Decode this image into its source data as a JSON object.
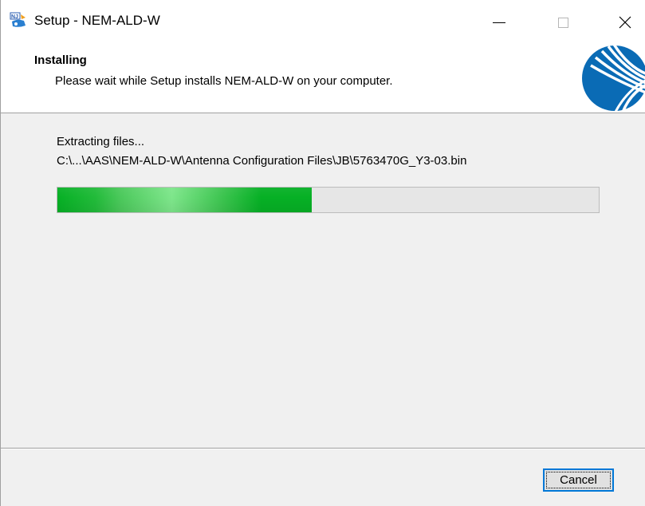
{
  "window": {
    "title": "Setup - NEM-ALD-W"
  },
  "header": {
    "title": "Installing",
    "subtitle": "Please wait while Setup installs NEM-ALD-W on your computer."
  },
  "main": {
    "status": "Extracting files...",
    "current_file": "C:\\...\\AAS\\NEM-ALD-W\\Antenna Configuration Files\\JB\\5763470G_Y3-03.bin",
    "progress": 0.47
  },
  "footer": {
    "cancel_label": "Cancel"
  },
  "colors": {
    "progress_fill": "#06b025",
    "progress_track": "#e6e6e6",
    "logo_blue": "#0a6bb5",
    "focus_border": "#0078d7"
  },
  "icons": {
    "app": "installer-app-icon",
    "logo": "company-logo-icon",
    "minimize": "minimize-icon",
    "maximize": "maximize-icon",
    "close": "close-icon"
  }
}
